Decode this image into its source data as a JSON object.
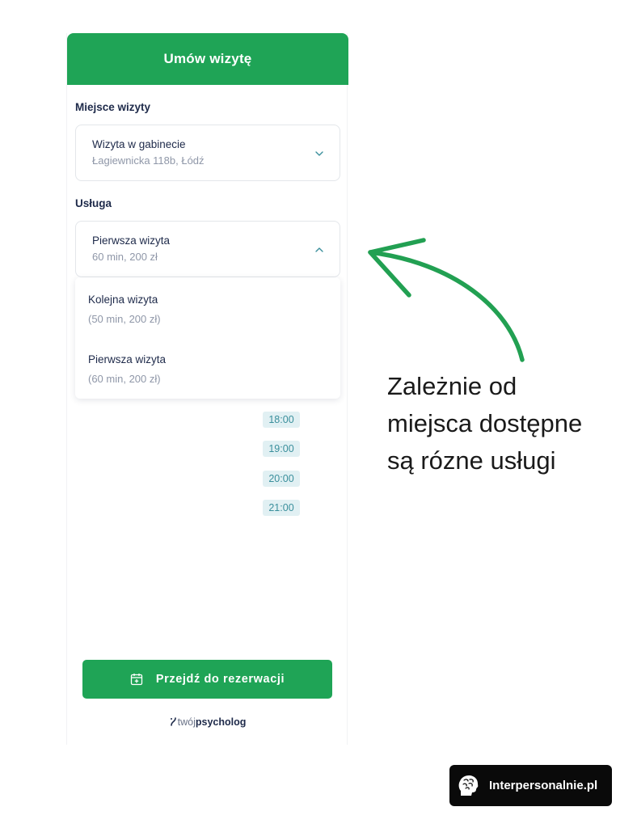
{
  "header": {
    "title": "Umów wizytę"
  },
  "location": {
    "label": "Miejsce wizyty",
    "selected_title": "Wizyta w gabinecie",
    "selected_sub": "Łagiewnicka 118b, Łódź"
  },
  "service": {
    "label": "Usługa",
    "selected_title": "Pierwsza wizyta",
    "selected_sub": "60 min, 200 zł",
    "options": [
      {
        "title": "Kolejna wizyta",
        "sub": "(50 min, 200 zł)"
      },
      {
        "title": "Pierwsza wizyta",
        "sub": "(60 min, 200 zł)"
      }
    ]
  },
  "time_slots": [
    "18:00",
    "19:00",
    "20:00",
    "21:00"
  ],
  "book_button": {
    "label": "Przejdź do rezerwacji"
  },
  "brand": {
    "light": "twój",
    "bold": "psycholog"
  },
  "annotation": {
    "line1": "Zależnie od",
    "line2": "miejsca dostępne",
    "line3": "są rózne usługi"
  },
  "badge": {
    "label": "Interpersonalnie.pl"
  },
  "colors": {
    "accent": "#1fa456",
    "slot_bg": "#e1f0f3",
    "slot_text": "#3a8f9c"
  },
  "icons": [
    "chevron-down-icon",
    "chevron-up-icon",
    "calendar-plus-icon",
    "brain-icon",
    "arrow-icon"
  ]
}
